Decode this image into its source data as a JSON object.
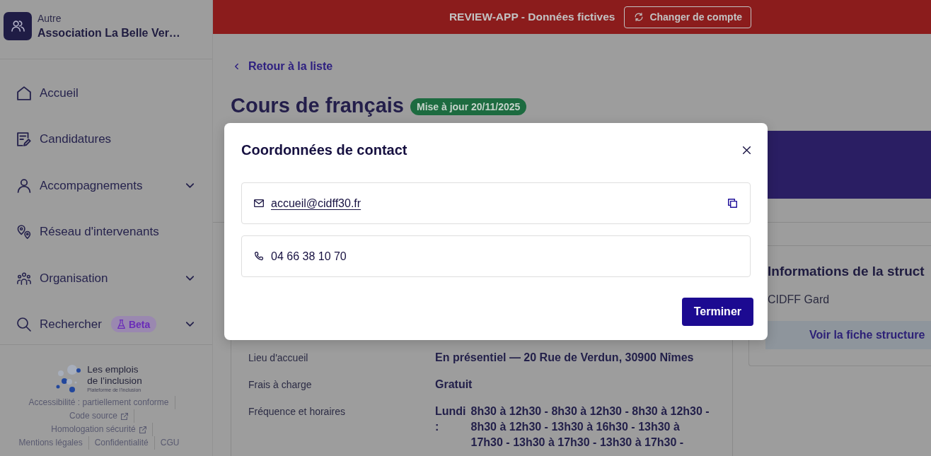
{
  "sidebar": {
    "account": {
      "type": "Autre",
      "name": "Association La Belle Ver…"
    },
    "nav": [
      {
        "label": "Accueil",
        "expandable": false
      },
      {
        "label": "Candidatures",
        "expandable": false
      },
      {
        "label": "Accompagnements",
        "expandable": true
      },
      {
        "label": "Réseau d'intervenants",
        "expandable": false
      },
      {
        "label": "Organisation",
        "expandable": true
      },
      {
        "label": "Rechercher",
        "badge": "Beta",
        "expandable": true
      }
    ],
    "footer": {
      "logo": {
        "line_1": "Les emplois",
        "line_2": "de l’inclusion",
        "tagline": "Plateforme de l’inclusion"
      },
      "link_rows": [
        [
          {
            "label": "Accessibilité : partiellement conforme",
            "external": false
          }
        ],
        [
          {
            "label": "Code source",
            "external": true
          }
        ],
        [
          {
            "label": "Homologation sécurité",
            "external": true
          }
        ],
        [
          {
            "label": "Mentions légales",
            "external": false
          },
          {
            "label": "Confidentialité",
            "external": false
          },
          {
            "label": "CGU",
            "external": false
          }
        ]
      ]
    }
  },
  "banner": {
    "text": "REVIEW-APP - Données fictives",
    "button": "Changer de compte"
  },
  "page": {
    "back_link": "Retour à la liste",
    "title": "Cours de français",
    "updated_badge": "Mise à jour 20/11/2025",
    "details": [
      {
        "kind": "text",
        "label": "Lieu d'accueil",
        "value": "En présentiel — 20 Rue de Verdun, 30900 Nîmes"
      },
      {
        "kind": "text",
        "label": "Frais à charge",
        "value": "Gratuit"
      },
      {
        "kind": "schedule",
        "label": "Fréquence et horaires",
        "days": [
          {
            "day": "Lundi :",
            "hours": "8h30 à 12h30 - 8h30 à 12h30 - 8h30 à 12h30 - 8h30 à 12h30 - 13h30 à 16h30 - 13h30 à 17h30 - 13h30 à 17h30 - 13h30 à 17h30 -"
          }
        ]
      }
    ],
    "structure_card": {
      "title": "Informations de la struct",
      "name": "CIDFF Gard",
      "button": "Voir la fiche structure"
    }
  },
  "modal": {
    "title": "Coordonnées de contact",
    "contacts": [
      {
        "kind": "email",
        "value": "accueil@cidff30.fr",
        "copyable": true
      },
      {
        "kind": "phone",
        "value": "04 66 38 10 70",
        "copyable": false
      }
    ],
    "button": "Terminer"
  }
}
